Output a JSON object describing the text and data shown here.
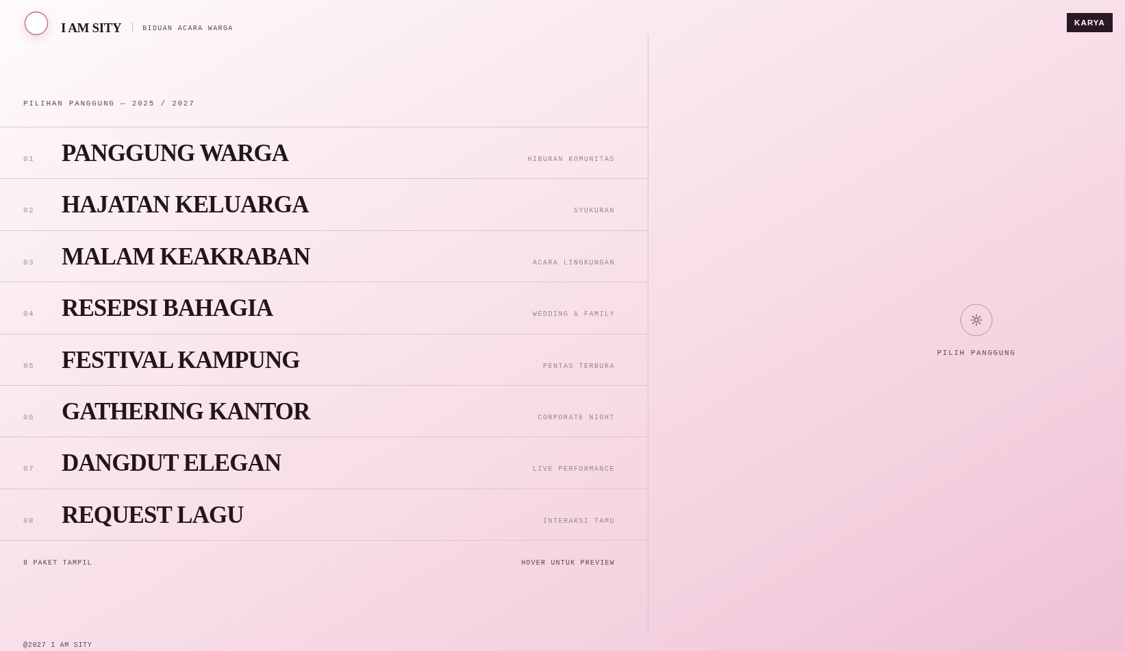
{
  "header": {
    "brand": "I AM SITY",
    "tagline": "BIDUAN ACARA WARGA",
    "nav_button": "KARYA"
  },
  "list": {
    "heading": "PILIHAN PANGGUNG — 2025 / 2027",
    "items": [
      {
        "number": "01",
        "title": "PANGGUNG WARGA",
        "tag": "HIBURAN KOMUNITAS",
        "selected": false
      },
      {
        "number": "02",
        "title": "HAJATAN KELUARGA",
        "tag": "SYUKURAN",
        "selected": false
      },
      {
        "number": "03",
        "title": "MALAM KEAKRABAN",
        "tag": "ACARA LINGKUNGAN",
        "selected": false
      },
      {
        "number": "04",
        "title": "RESEPSI BAHAGIA",
        "tag": "WEDDING & FAMILY",
        "selected": false
      },
      {
        "number": "05",
        "title": "FESTIVAL KAMPUNG",
        "tag": "PENTAS TERBUKA",
        "selected": false
      },
      {
        "number": "06",
        "title": "GATHERING KANTOR",
        "tag": "CORPORATE NIGHT",
        "selected": false
      },
      {
        "number": "07",
        "title": "DANGDUT ELEGAN",
        "tag": "LIVE PERFORMANCE",
        "selected": false
      },
      {
        "number": "08",
        "title": "REQUEST LAGU",
        "tag": "INTERAKSI TAMU",
        "selected": false
      }
    ],
    "count": "8 PAKET TAMPIL",
    "hint": "HOVER UNTUK PREVIEW"
  },
  "preview": {
    "label": "PILIH PANGGUNG"
  },
  "footer": {
    "copyright": "@2027 I AM SITY"
  }
}
